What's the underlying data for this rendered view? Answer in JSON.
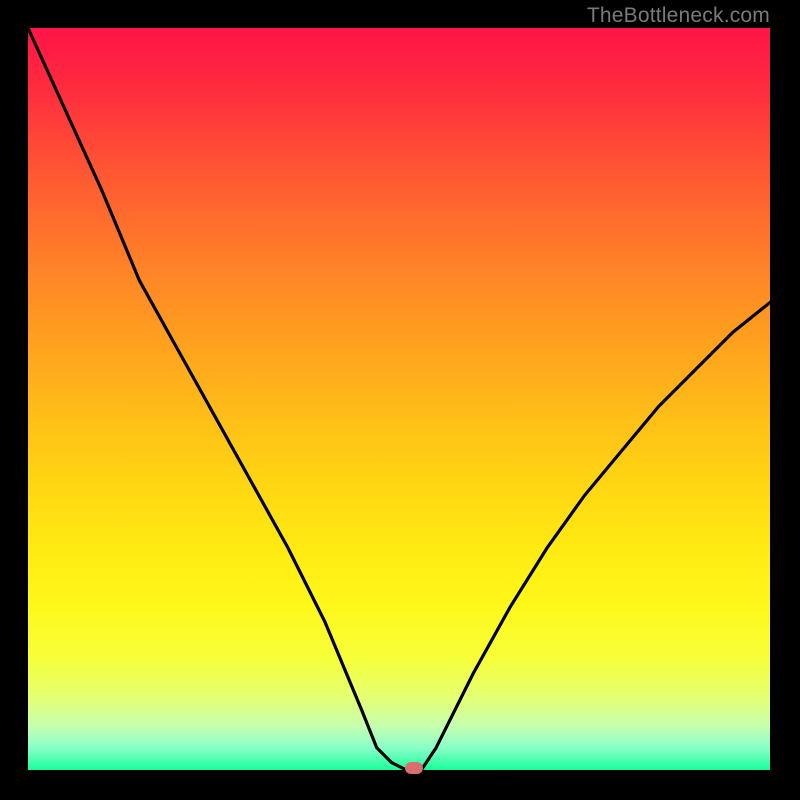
{
  "watermark": "TheBottleneck.com",
  "marker_color": "#d96e6e",
  "chart_data": {
    "type": "line",
    "title": "",
    "xlabel": "",
    "ylabel": "",
    "xlim": [
      0,
      100
    ],
    "ylim": [
      0,
      100
    ],
    "x": [
      0,
      5,
      10,
      15,
      20,
      25,
      30,
      35,
      40,
      45,
      47,
      49,
      51,
      53,
      55,
      60,
      65,
      70,
      75,
      80,
      85,
      90,
      95,
      100
    ],
    "y": [
      100,
      89,
      78,
      66,
      57,
      48,
      39,
      30,
      20,
      8,
      3,
      1,
      0,
      0,
      3,
      13,
      22,
      30,
      37,
      43,
      49,
      54,
      59,
      63
    ],
    "minimum_x": 52,
    "minimum_y": 0,
    "note": "Values estimated from pixel positions; y=0 is chart bottom (green), y=100 is top (red)."
  }
}
